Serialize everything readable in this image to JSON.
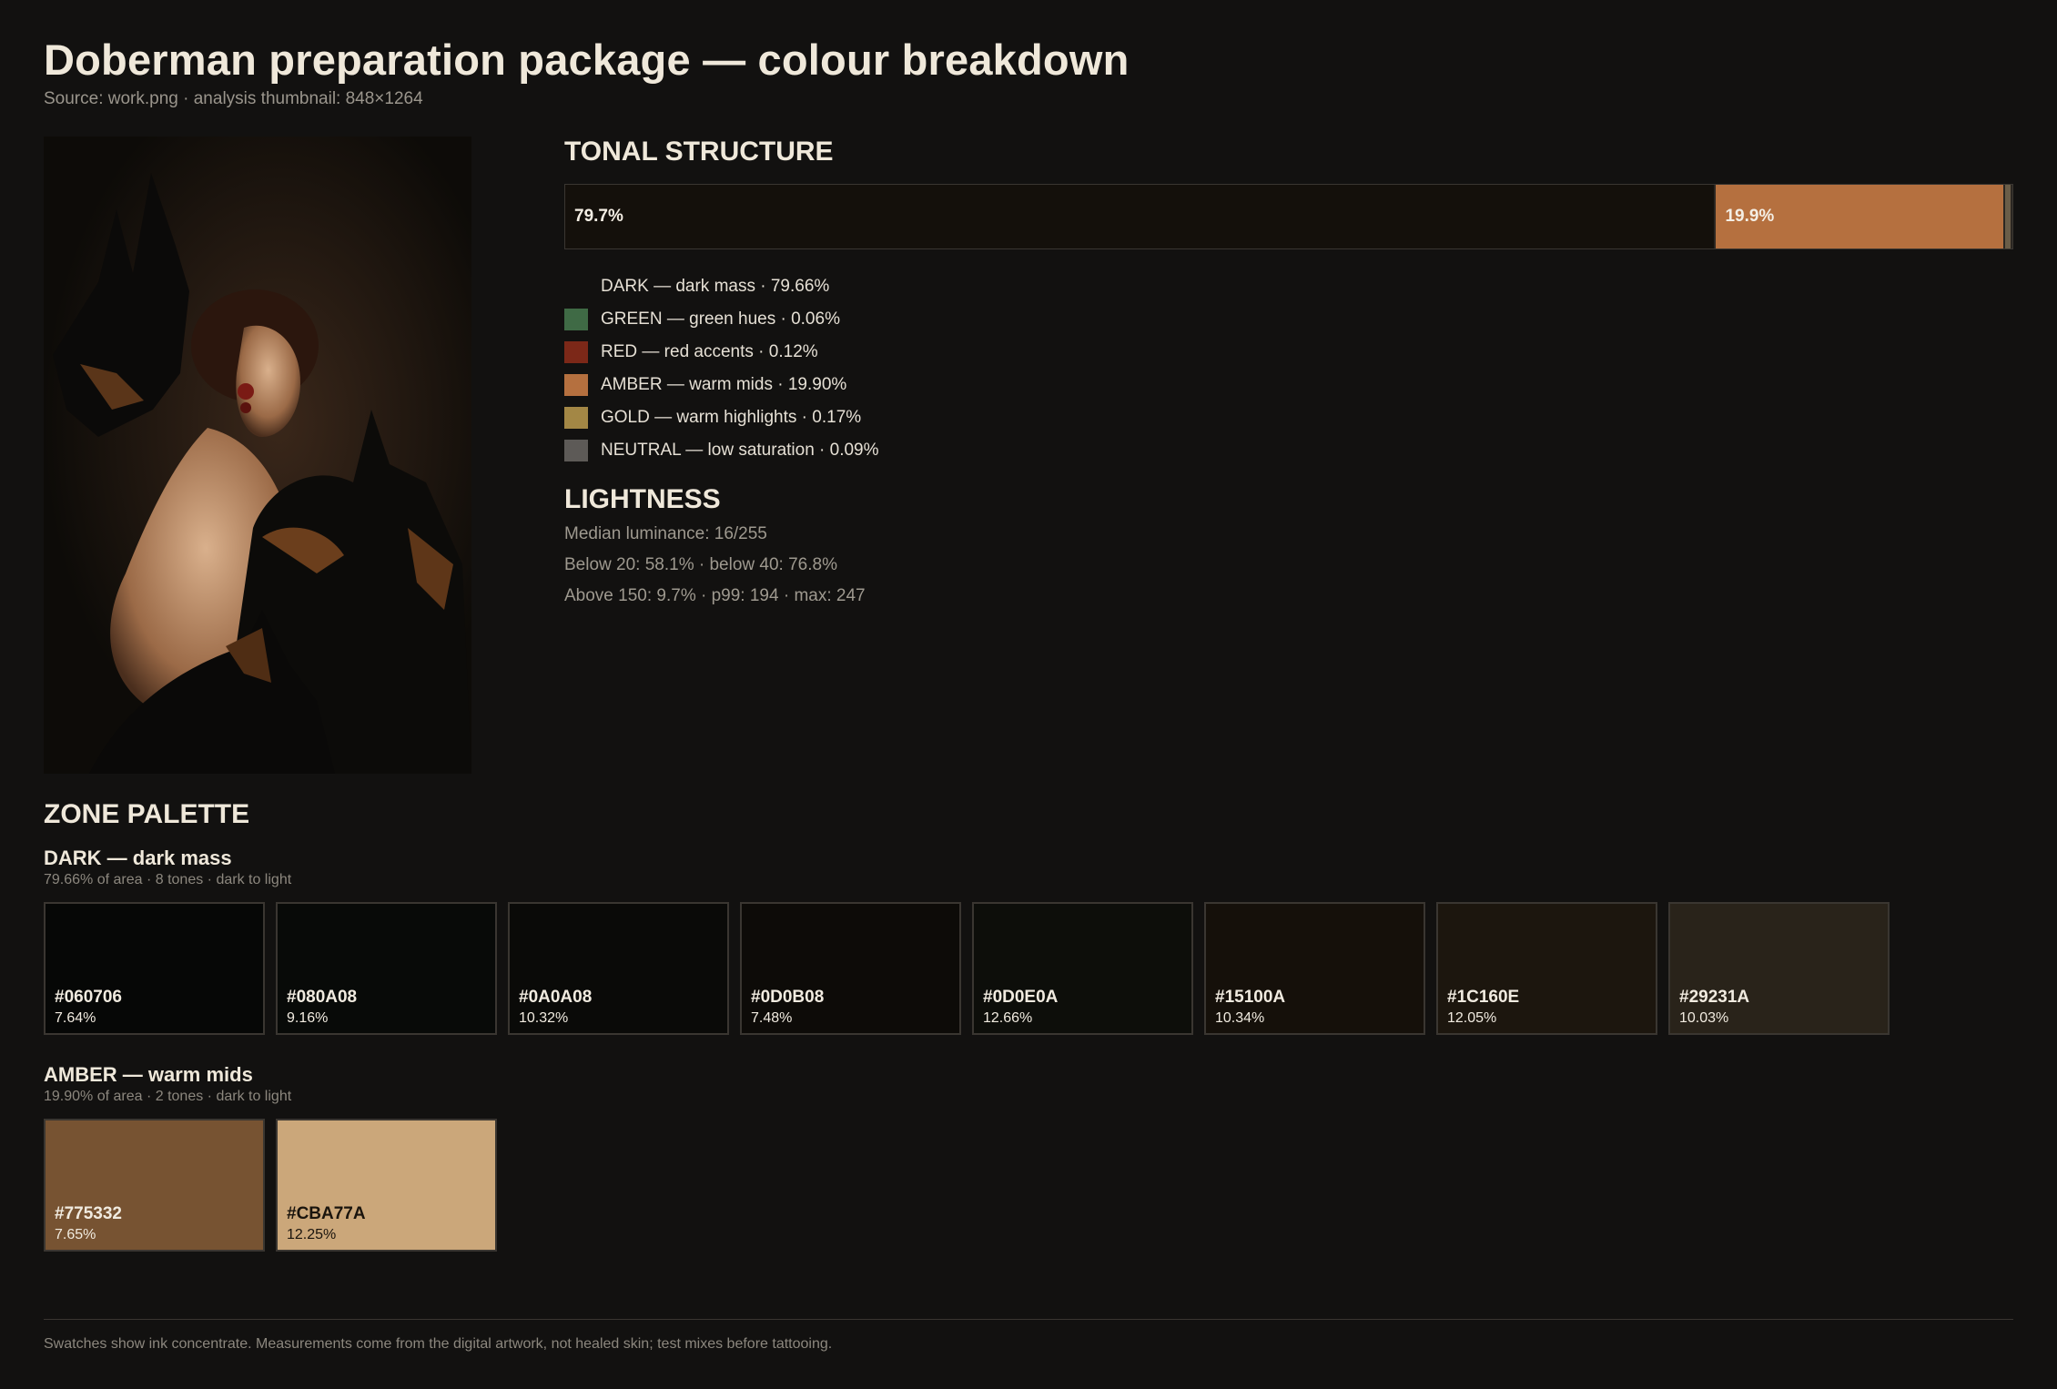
{
  "header": {
    "title": "Doberman preparation package — colour breakdown",
    "subtitle": "Source: work.png · analysis thumbnail: 848×1264"
  },
  "artwork": {
    "description": "artwork thumbnail"
  },
  "tonal": {
    "heading": "TONAL STRUCTURE",
    "bar": [
      {
        "label": "79.7%",
        "fraction": 0.797,
        "color": "#14100b"
      },
      {
        "label": "19.9%",
        "fraction": 0.199,
        "color": "#b5703f"
      },
      {
        "label": "",
        "fraction": 0.004,
        "color": "#6a5d48"
      }
    ],
    "legend": [
      {
        "text": "DARK — dark mass · 79.66%",
        "color": "#121110"
      },
      {
        "text": "GREEN — green hues · 0.06%",
        "color": "#3f6a45"
      },
      {
        "text": "RED — red accents · 0.12%",
        "color": "#7c2818"
      },
      {
        "text": "AMBER — warm mids · 19.90%",
        "color": "#b5703f"
      },
      {
        "text": "GOLD — warm highlights · 0.17%",
        "color": "#a38745"
      },
      {
        "text": "NEUTRAL — low saturation · 0.09%",
        "color": "#5d5a57"
      }
    ]
  },
  "lightness": {
    "heading": "LIGHTNESS",
    "lines": [
      "Median luminance: 16/255",
      "Below 20: 58.1% · below 40: 76.8%",
      "Above 150: 9.7% · p99: 194 · max: 247"
    ]
  },
  "zone_palette": {
    "heading": "ZONE PALETTE",
    "groups": [
      {
        "title": "DARK — dark mass",
        "subtitle": "79.66% of area · 8 tones · dark to light",
        "swatches": [
          {
            "hex": "#060706",
            "pct": "7.64%"
          },
          {
            "hex": "#080A08",
            "pct": "9.16%"
          },
          {
            "hex": "#0A0A08",
            "pct": "10.32%"
          },
          {
            "hex": "#0D0B08",
            "pct": "7.48%"
          },
          {
            "hex": "#0D0E0A",
            "pct": "12.66%"
          },
          {
            "hex": "#15100A",
            "pct": "10.34%"
          },
          {
            "hex": "#1C160E",
            "pct": "12.05%"
          },
          {
            "hex": "#29231A",
            "pct": "10.03%"
          }
        ]
      },
      {
        "title": "AMBER — warm mids",
        "subtitle": "19.90% of area · 2 tones · dark to light",
        "swatches": [
          {
            "hex": "#775332",
            "pct": "7.65%"
          },
          {
            "hex": "#CBA77A",
            "pct": "12.25%"
          }
        ]
      }
    ]
  },
  "footer": {
    "note": "Swatches show ink concentrate. Measurements come from the digital artwork, not healed skin; test mixes before tattooing."
  }
}
